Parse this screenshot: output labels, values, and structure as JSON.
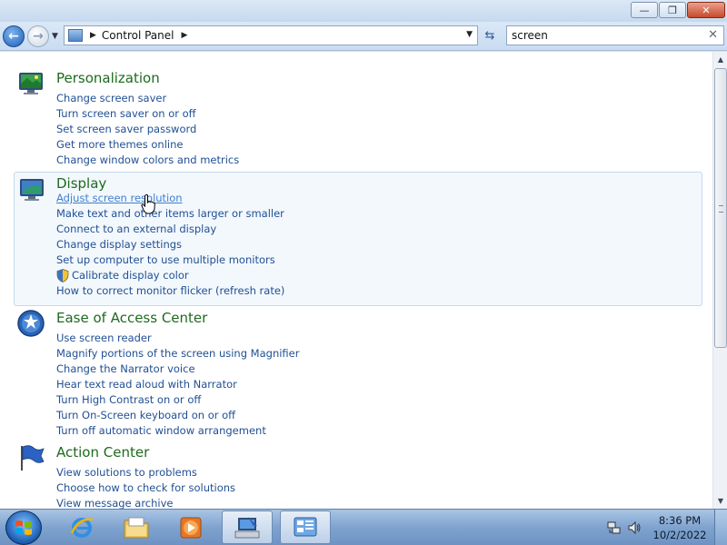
{
  "window": {
    "minimize": "—",
    "maximize": "❐",
    "close": "✕"
  },
  "address": {
    "path": "Control Panel",
    "search_value": "screen"
  },
  "groups": [
    {
      "title": "Personalization",
      "icon": "personalization-icon",
      "links": [
        "Change screen saver",
        "Turn screen saver on or off",
        "Set screen saver password",
        "Get more themes online",
        "Change window colors and metrics"
      ]
    },
    {
      "title": "Display",
      "icon": "display-icon",
      "links": [
        "Adjust screen resolution",
        "Make text and other items larger or smaller",
        "Connect to an external display",
        "Change display settings",
        "Set up computer to use multiple monitors",
        "Calibrate display color",
        "How to correct monitor flicker (refresh rate)"
      ]
    },
    {
      "title": "Ease of Access Center",
      "icon": "ease-of-access-icon",
      "links": [
        "Use screen reader",
        "Magnify portions of the screen using Magnifier",
        "Change the Narrator voice",
        "Hear text read aloud with Narrator",
        "Turn High Contrast on or off",
        "Turn On-Screen keyboard on or off",
        "Turn off automatic window arrangement"
      ]
    },
    {
      "title": "Action Center",
      "icon": "action-center-flag-icon",
      "links": [
        "View solutions to problems",
        "Choose how to check for solutions",
        "View message archive"
      ]
    }
  ],
  "taskbar": {
    "time": "8:36 PM",
    "date": "10/2/2022"
  }
}
